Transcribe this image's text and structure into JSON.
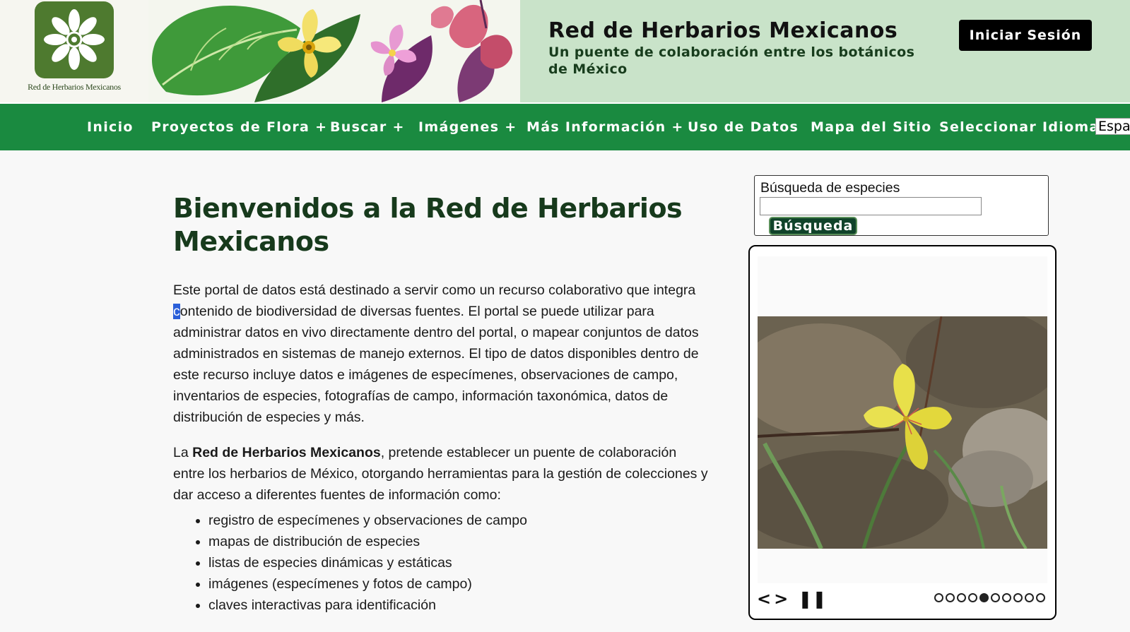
{
  "header": {
    "logo_caption": "Red de Herbarios Mexicanos",
    "title": "Red de Herbarios Mexicanos",
    "subtitle": "Un puente de colaboración entre los botánicos de México",
    "login_label": "Iniciar Sesión"
  },
  "nav": {
    "items": [
      {
        "label": "Inicio"
      },
      {
        "label": "Proyectos de Flora +"
      },
      {
        "label": "Buscar +"
      },
      {
        "label": "Imágenes +"
      },
      {
        "label": "Más Información +"
      },
      {
        "label": "Uso de Datos"
      },
      {
        "label": "Mapa del Sitio"
      }
    ],
    "language_label": "Seleccionar Idioma:",
    "language_value": "Español"
  },
  "main": {
    "title": "Bienvenidos a la Red de Herbarios Mexicanos",
    "intro_before_cursor": "Este portal de datos está destinado a servir como un recurso colaborativo que integra ",
    "intro_cursor_char": "c",
    "intro_after_cursor": "ontenido de biodiversidad de diversas fuentes. El portal se puede utilizar para administrar datos en vivo directamente dentro del portal, o mapear conjuntos de datos administrados en sistemas de manejo externos. El tipo de datos disponibles dentro de este recurso incluye datos e imágenes de especímenes, observaciones de campo, inventarios de especies, fotografías de campo, información taxonómica, datos de distribución de especies y más.",
    "mission_prefix": "La ",
    "mission_bold": "Red de Herbarios Mexicanos",
    "mission_suffix": ", pretende establecer un puente de colaboración entre los herbarios de México, otorgando herramientas para la gestión de colecciones y dar acceso a diferentes fuentes de información como:",
    "features": [
      "registro de especímenes y observaciones de campo",
      "mapas de distribución de especies",
      "listas de especies dinámicas y estáticas",
      "imágenes (especímenes y fotos de campo)",
      "claves interactivas para identificación"
    ]
  },
  "sidebar": {
    "species_search_label": "Búsqueda de especies",
    "species_search_value": "",
    "search_button_label": "Búsqueda",
    "slideshow": {
      "dot_count": 10,
      "active_dot": 4
    }
  },
  "colors": {
    "nav_green": "#1a8a40",
    "header_green": "#c9e3c9",
    "title_green": "#173a1c",
    "logo_green": "#4e7a2f"
  }
}
